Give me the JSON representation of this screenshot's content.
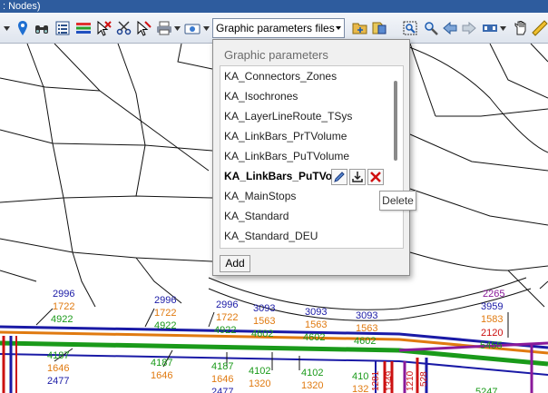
{
  "window": {
    "title_fragment": ": Nodes)"
  },
  "toolbar": {
    "graphic_params_combo": "Graphic parameters files",
    "icons": [
      "pin-icon",
      "binoculars-icon",
      "list-icon",
      "filter-bars-icon",
      "cursor-select-icon",
      "scissors-icon",
      "edit-cursor-icon",
      "print-icon",
      "camera-icon",
      "open-folder-icon",
      "save-icon",
      "zoom-window-icon",
      "zoom-icon",
      "back-icon",
      "forward-icon",
      "view-icon",
      "hand-icon",
      "ruler-icon"
    ]
  },
  "popup": {
    "title": "Graphic parameters",
    "items": [
      "KA_Connectors_Zones",
      "KA_Isochrones",
      "KA_LayerLineRoute_TSys",
      "KA_LinkBars_PrTVolume",
      "KA_LinkBars_PuTVolume",
      "KA_LinkBars_PuTVo",
      "KA_MainStops",
      "KA_Standard",
      "KA_Standard_DEU"
    ],
    "selected_index": 5,
    "add_label": "Add",
    "tooltip": "Delete"
  },
  "map": {
    "labels": [
      {
        "t": "2996",
        "c": "blue"
      },
      {
        "t": "1722",
        "c": "orange"
      },
      {
        "t": "4922",
        "c": "green"
      },
      {
        "t": "2996",
        "c": "blue"
      },
      {
        "t": "1722",
        "c": "orange"
      },
      {
        "t": "4922",
        "c": "green"
      },
      {
        "t": "2996",
        "c": "blue"
      },
      {
        "t": "1722",
        "c": "orange"
      },
      {
        "t": "4922",
        "c": "green"
      },
      {
        "t": "3093",
        "c": "blue"
      },
      {
        "t": "1563",
        "c": "orange"
      },
      {
        "t": "4602",
        "c": "green"
      },
      {
        "t": "3093",
        "c": "blue"
      },
      {
        "t": "1563",
        "c": "orange"
      },
      {
        "t": "4602",
        "c": "green"
      },
      {
        "t": "3093",
        "c": "blue"
      },
      {
        "t": "1563",
        "c": "orange"
      },
      {
        "t": "4602",
        "c": "green"
      },
      {
        "t": "2265",
        "c": "purple"
      },
      {
        "t": "3959",
        "c": "blue"
      },
      {
        "t": "1583",
        "c": "orange"
      },
      {
        "t": "2120",
        "c": "red"
      },
      {
        "t": "5455",
        "c": "green"
      },
      {
        "t": "4187",
        "c": "green"
      },
      {
        "t": "1646",
        "c": "orange"
      },
      {
        "t": "2477",
        "c": "blue"
      },
      {
        "t": "4187",
        "c": "green"
      },
      {
        "t": "1646",
        "c": "orange"
      },
      {
        "t": "4187",
        "c": "green"
      },
      {
        "t": "1646",
        "c": "orange"
      },
      {
        "t": "2477",
        "c": "blue"
      },
      {
        "t": "4102",
        "c": "green"
      },
      {
        "t": "1320",
        "c": "orange"
      },
      {
        "t": "4102",
        "c": "green"
      },
      {
        "t": "1320",
        "c": "orange"
      },
      {
        "t": "410",
        "c": "green"
      },
      {
        "t": "132",
        "c": "orange"
      },
      {
        "t": "1281",
        "c": "red"
      },
      {
        "t": "1349",
        "c": "red"
      },
      {
        "t": "1210",
        "c": "red"
      },
      {
        "t": "528",
        "c": "red"
      },
      {
        "t": "5247",
        "c": "green"
      }
    ]
  }
}
